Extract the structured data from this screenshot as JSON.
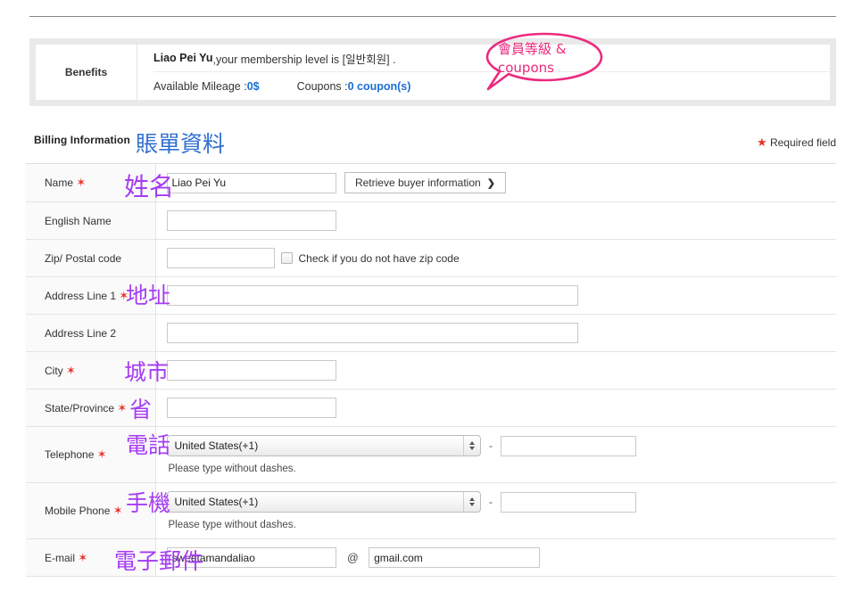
{
  "benefits": {
    "label": "Benefits",
    "user_name": "Liao Pei Yu",
    "membership_text": ",your membership level is [일반회원] .",
    "mileage_label": "Available Mileage : ",
    "mileage_value": "0$",
    "coupons_label": "Coupons : ",
    "coupons_value": "0 coupon(s)"
  },
  "section": {
    "title": "Billing Information",
    "title_annotation": "賬單資料",
    "required_star": "★",
    "required_note": "Required field"
  },
  "form": {
    "rows": {
      "name": {
        "label": "Name",
        "annotation": "姓名",
        "value": "Liao Pei Yu",
        "button": "Retrieve buyer information",
        "button_chevron": "❯"
      },
      "english_name": {
        "label": "English Name",
        "value": ""
      },
      "zip": {
        "label": "Zip/ Postal code",
        "value": "",
        "checkbox_label": "Check if you do not have zip code"
      },
      "address1": {
        "label": "Address Line 1",
        "annotation": "地址",
        "value": ""
      },
      "address2": {
        "label": "Address Line 2",
        "value": ""
      },
      "city": {
        "label": "City",
        "annotation": "城市",
        "value": ""
      },
      "state": {
        "label": "State/Province",
        "annotation": "省",
        "value": ""
      },
      "telephone": {
        "label": "Telephone",
        "annotation": "電話",
        "country": "United States(+1)",
        "number": "",
        "separator": "-",
        "hint": "Please type without dashes."
      },
      "mobile": {
        "label": "Mobile Phone",
        "annotation": "手機",
        "country": "United States(+1)",
        "number": "",
        "separator": "-",
        "hint": "Please type without dashes."
      },
      "email": {
        "label": "E-mail",
        "annotation": "電子郵件",
        "local": "sweetamandaliao",
        "at": "@",
        "domain": "gmail.com"
      }
    }
  },
  "callout": {
    "line1": "會員等級 &",
    "line2": "coupons"
  },
  "colors": {
    "annotation_purple": "#a53cf4",
    "annotation_blue": "#2f6fd0",
    "callout_pink": "#ec2a7e",
    "required_red": "#e8342a",
    "link_blue": "#1a6fd4"
  }
}
